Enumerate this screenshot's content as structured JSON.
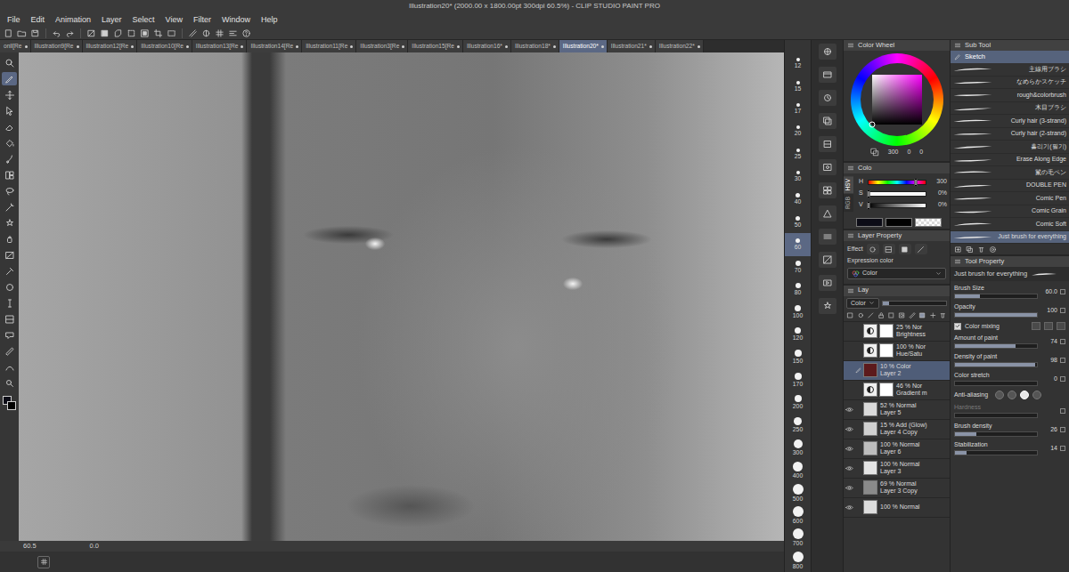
{
  "window": {
    "title": "Illustration20* (2000.00 x 1800.00pt 300dpi 60.5%) - CLIP STUDIO PAINT PRO"
  },
  "menu": [
    "File",
    "Edit",
    "Animation",
    "Layer",
    "Select",
    "View",
    "Filter",
    "Window",
    "Help"
  ],
  "tabs": [
    {
      "label": "onll[Re",
      "selected": false
    },
    {
      "label": "Illustration9[Re",
      "selected": false
    },
    {
      "label": "Illustration12[Re",
      "selected": false
    },
    {
      "label": "Illustration10[Re",
      "selected": false
    },
    {
      "label": "Illustration13[Re",
      "selected": false
    },
    {
      "label": "Illustration14[Re",
      "selected": false
    },
    {
      "label": "Illustration11[Re",
      "selected": false
    },
    {
      "label": "Illustration3[Re",
      "selected": false
    },
    {
      "label": "Illustration15[Re",
      "selected": false
    },
    {
      "label": "Illustration16*",
      "selected": false
    },
    {
      "label": "Illustration18*",
      "selected": false
    },
    {
      "label": "Illustration20*",
      "selected": true
    },
    {
      "label": "Illustration21*",
      "selected": false
    },
    {
      "label": "Illustration22*",
      "selected": false
    }
  ],
  "tools": [
    {
      "selected": false
    },
    {
      "selected": true
    },
    {
      "selected": false
    },
    {
      "selected": false
    },
    {
      "selected": false
    },
    {
      "selected": false
    },
    {
      "selected": false
    },
    {
      "selected": false
    },
    {
      "selected": false
    },
    {
      "selected": false
    },
    {
      "selected": false
    },
    {
      "selected": false
    },
    {
      "selected": false
    },
    {
      "selected": false
    },
    {
      "selected": false
    },
    {
      "selected": false
    },
    {
      "selected": false
    },
    {
      "selected": false
    },
    {
      "selected": false
    },
    {
      "selected": false
    },
    {
      "selected": false
    }
  ],
  "status_bar": {
    "zoom": "60.5",
    "angle": "0.0"
  },
  "brush_sizes": [
    {
      "label": "12",
      "selected": false
    },
    {
      "label": "15",
      "selected": false
    },
    {
      "label": "17",
      "selected": false
    },
    {
      "label": "20",
      "selected": false
    },
    {
      "label": "25",
      "selected": false
    },
    {
      "label": "30",
      "selected": false
    },
    {
      "label": "40",
      "selected": false
    },
    {
      "label": "50",
      "selected": false
    },
    {
      "label": "60",
      "selected": true
    },
    {
      "label": "70",
      "selected": false
    },
    {
      "label": "80",
      "selected": false
    },
    {
      "label": "100",
      "selected": false
    },
    {
      "label": "120",
      "selected": false
    },
    {
      "label": "150",
      "selected": false
    },
    {
      "label": "170",
      "selected": false
    },
    {
      "label": "200",
      "selected": false
    },
    {
      "label": "250",
      "selected": false
    },
    {
      "label": "300",
      "selected": false
    },
    {
      "label": "400",
      "selected": false
    },
    {
      "label": "500",
      "selected": false
    },
    {
      "label": "600",
      "selected": false
    },
    {
      "label": "700",
      "selected": false
    },
    {
      "label": "800",
      "selected": false
    }
  ],
  "color_wheel": {
    "title": "Color Wheel",
    "values": [
      "300",
      "0",
      "0"
    ]
  },
  "color_slider": {
    "title": "Colo",
    "modes": [
      {
        "label": "HSV",
        "selected": true
      },
      {
        "label": "RGB",
        "selected": false
      }
    ],
    "channels": [
      {
        "label": "H",
        "value": "300",
        "level": 0.833
      },
      {
        "label": "S",
        "value": "0%",
        "level": 0
      },
      {
        "label": "V",
        "value": "0%",
        "level": 0
      }
    ],
    "swatches": [
      {
        "kind": "color",
        "color": "#0c0c16"
      },
      {
        "kind": "color",
        "color": "#020202"
      },
      {
        "kind": "transparent"
      }
    ]
  },
  "layer_property": {
    "title": "Layer Property",
    "effect_label": "Effect",
    "expression_label": "Expression color",
    "expression_value": "Color"
  },
  "layer_panel": {
    "title": "Lay",
    "blend_mode": "Color",
    "opacity_level": 0.1,
    "layers": [
      {
        "opacity": "25 % Nor",
        "name": "Brightness",
        "visible": false,
        "selected": false,
        "editing": false,
        "mask": true,
        "kind": "adjustment",
        "color": "#f0f0f0"
      },
      {
        "opacity": "100 % Nor",
        "name": "Hue/Satu",
        "visible": false,
        "selected": false,
        "editing": false,
        "mask": true,
        "kind": "adjustment",
        "color": "#f0f0f0"
      },
      {
        "opacity": "10 % Color",
        "name": "Layer 2",
        "visible": false,
        "selected": true,
        "editing": true,
        "mask": false,
        "kind": "raster",
        "color": "#5c1a1c"
      },
      {
        "opacity": "46 % Nor",
        "name": "Gradient m",
        "visible": false,
        "selected": false,
        "editing": false,
        "mask": true,
        "kind": "adjustment",
        "color": "#f0f0f0"
      },
      {
        "opacity": "52 % Normal",
        "name": "Layer 5",
        "visible": true,
        "selected": false,
        "editing": false,
        "mask": false,
        "kind": "raster",
        "color": "#dadada"
      },
      {
        "opacity": "15 % Add (Glow)",
        "name": "Layer 4 Copy",
        "visible": true,
        "selected": false,
        "editing": false,
        "mask": false,
        "kind": "raster",
        "color": "#d0d0d0"
      },
      {
        "opacity": "100 % Normal",
        "name": "Layer 6",
        "visible": true,
        "selected": false,
        "editing": false,
        "mask": false,
        "kind": "raster",
        "color": "#bdbdbd"
      },
      {
        "opacity": "100 % Normal",
        "name": "Layer 3",
        "visible": true,
        "selected": false,
        "editing": false,
        "mask": false,
        "kind": "raster",
        "color": "#e4e4e4"
      },
      {
        "opacity": "69 % Normal",
        "name": "Layer 3 Copy",
        "visible": true,
        "selected": false,
        "editing": false,
        "mask": false,
        "kind": "raster",
        "color": "#8a8a8a"
      },
      {
        "opacity": "100 % Normal",
        "visible": true,
        "selected": false,
        "editing": false,
        "mask": false,
        "kind": "raster",
        "color": "#dddddd"
      }
    ]
  },
  "sub_tool": {
    "title": "Sub Tool",
    "group": "Sketch",
    "brushes": [
      {
        "label": "主線用ブラシ",
        "selected": false
      },
      {
        "label": "なめらかスケッチ",
        "selected": false
      },
      {
        "label": "rough&colorbrush",
        "selected": false
      },
      {
        "label": "木目ブラシ",
        "selected": false
      },
      {
        "label": "Curly hair (3-strand)",
        "selected": false
      },
      {
        "label": "Curly hair (2-strand)",
        "selected": false
      },
      {
        "label": "흘리기(필기)",
        "selected": false
      },
      {
        "label": "Erase Along Edge",
        "selected": false
      },
      {
        "label": "鬣の毛ペン",
        "selected": false
      },
      {
        "label": "DOUBLE PEN",
        "selected": false
      },
      {
        "label": "Comic Pen",
        "selected": false
      },
      {
        "label": "Comic Grain",
        "selected": false
      },
      {
        "label": "Comic Soft",
        "selected": false
      },
      {
        "label": "Just brush for everything",
        "selected": true
      }
    ]
  },
  "tool_property": {
    "title": "Tool Property",
    "brush_name": "Just brush for everything",
    "props": [
      {
        "kind": "slider",
        "label": "Brush Size",
        "value": "60.0",
        "level": 0.3,
        "disabled": false
      },
      {
        "kind": "slider",
        "label": "Opacity",
        "value": "100",
        "level": 1,
        "disabled": false
      },
      {
        "kind": "check",
        "label": "Color mixing",
        "checked": true
      },
      {
        "kind": "slider",
        "label": "Amount of paint",
        "value": "74",
        "level": 0.74,
        "disabled": false
      },
      {
        "kind": "slider",
        "label": "Density of paint",
        "value": "98",
        "level": 0.98,
        "disabled": false
      },
      {
        "kind": "slider",
        "label": "Color stretch",
        "value": "0",
        "level": 0,
        "disabled": false
      },
      {
        "kind": "choice",
        "label": "Anti-aliasing",
        "options": [
          {
            "selected": false
          },
          {
            "selected": false
          },
          {
            "selected": true
          },
          {
            "selected": false
          }
        ]
      },
      {
        "kind": "slider",
        "label": "Hardness",
        "level": 0,
        "disabled": true
      },
      {
        "kind": "slider",
        "label": "Brush density",
        "value": "26",
        "level": 0.26,
        "disabled": false
      },
      {
        "kind": "slider",
        "label": "Stabilization",
        "value": "14",
        "level": 0.14,
        "disabled": false
      }
    ]
  }
}
